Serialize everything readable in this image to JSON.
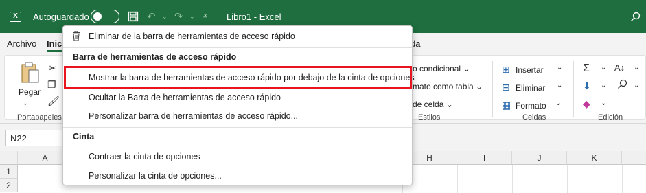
{
  "titlebar": {
    "app_icon": "excel-logo-icon",
    "autosave_label": "Autoguardado",
    "autosave_on": false,
    "qat_icons": [
      "save-icon",
      "undo-icon",
      "redo-icon",
      "customize-qat-icon"
    ],
    "doc_title": "Libro1  -  Excel",
    "search_icon": "search-icon"
  },
  "tabs": [
    "Archivo",
    "Inici",
    "da"
  ],
  "ribbon": {
    "paste_label": "Pegar",
    "clipboard_group": "Portapapeles",
    "styles": [
      "o condicional",
      "mato como tabla",
      "de celda"
    ],
    "styles_group": "Estilos",
    "cells": [
      "Insertar",
      "Eliminar",
      "Formato"
    ],
    "cells_group": "Celdas",
    "editing_group": "Edición"
  },
  "namebox": "N22",
  "columns": [
    "A",
    "H",
    "I",
    "J",
    "K"
  ],
  "rows": [
    "1",
    "2"
  ],
  "menu": {
    "remove_item": "Eliminar de la barra de herramientas de acceso rápido",
    "qat_header": "Barra de herramientas de acceso rápido",
    "show_below": "Mostrar la barra de herramientas de acceso rápido por debajo de la cinta de opciones",
    "hide_qat": "Ocultar la Barra de herramientas de acceso rápido",
    "customize_qat": "Personalizar barra de herramientas de acceso rápido...",
    "ribbon_header": "Cinta",
    "collapse_ribbon": "Contraer la cinta de opciones",
    "customize_ribbon": "Personalizar la cinta de opciones..."
  },
  "colors": {
    "titlebar": "#1e6e3f",
    "highlight": "#e8141f"
  }
}
